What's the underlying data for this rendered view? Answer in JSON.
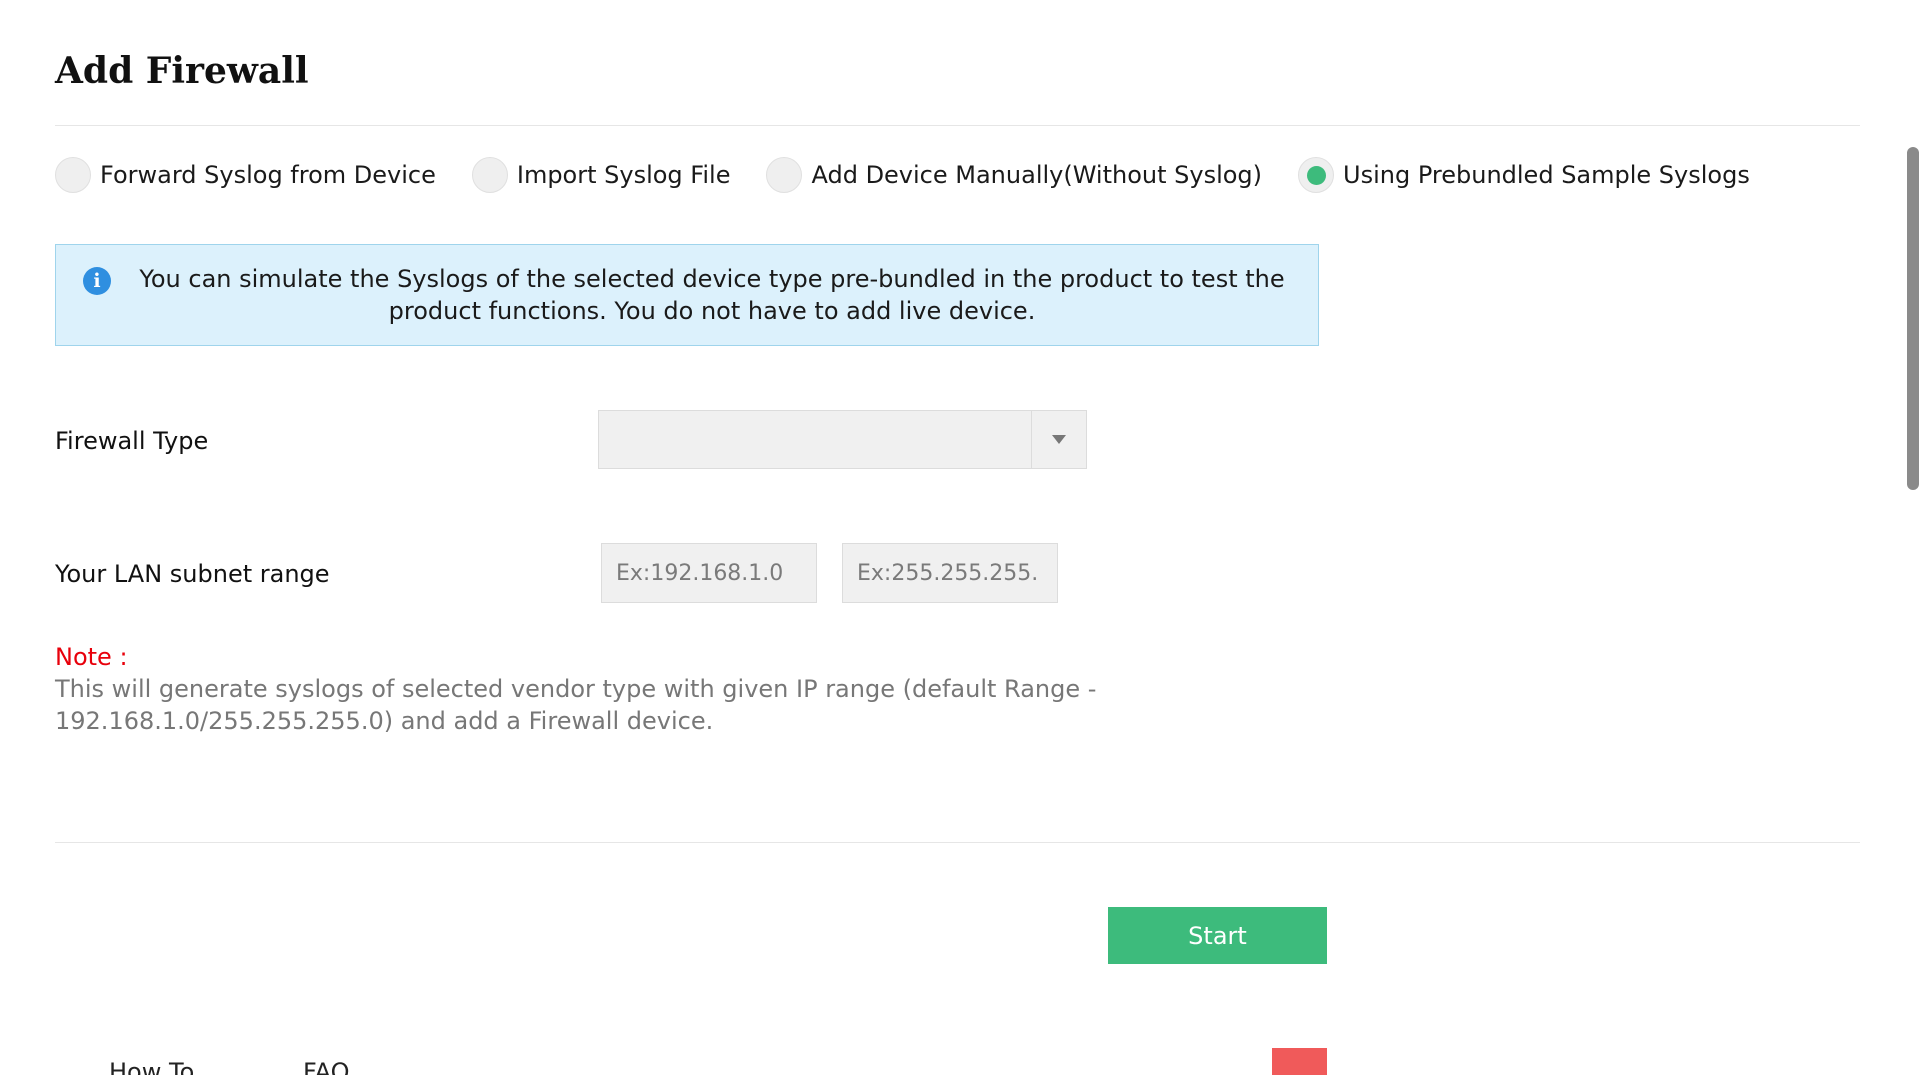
{
  "page": {
    "title": "Add Firewall"
  },
  "modes": [
    {
      "label": "Forward Syslog from Device",
      "selected": false
    },
    {
      "label": "Import Syslog File",
      "selected": false
    },
    {
      "label": "Add Device Manually(Without Syslog)",
      "selected": false
    },
    {
      "label": "Using Prebundled Sample Syslogs",
      "selected": true
    }
  ],
  "info": {
    "icon": "info-icon",
    "glyph": "i",
    "text": "You can simulate the Syslogs of the selected device type pre-bundled in the product to test the product functions. You do not have to add live device."
  },
  "form": {
    "firewall_type_label": "Firewall Type",
    "firewall_type_value": "",
    "lan_label": "Your LAN subnet range",
    "ip_placeholder": "Ex:192.168.1.0",
    "mask_placeholder": "Ex:255.255.255.",
    "ip_value": "",
    "mask_value": ""
  },
  "note": {
    "title": "Note :",
    "text": "This will generate syslogs of selected vendor type with given IP range (default Range - 192.168.1.0/255.255.255.0) and add a Firewall device."
  },
  "actions": {
    "start_label": "Start"
  },
  "footer": {
    "how_to": "How To",
    "faq": "FAQ"
  },
  "colors": {
    "accent_green": "#3dbb7c",
    "info_bg": "#dcf1fc",
    "note_red": "#e8000b",
    "badge_red": "#f05a5a"
  }
}
